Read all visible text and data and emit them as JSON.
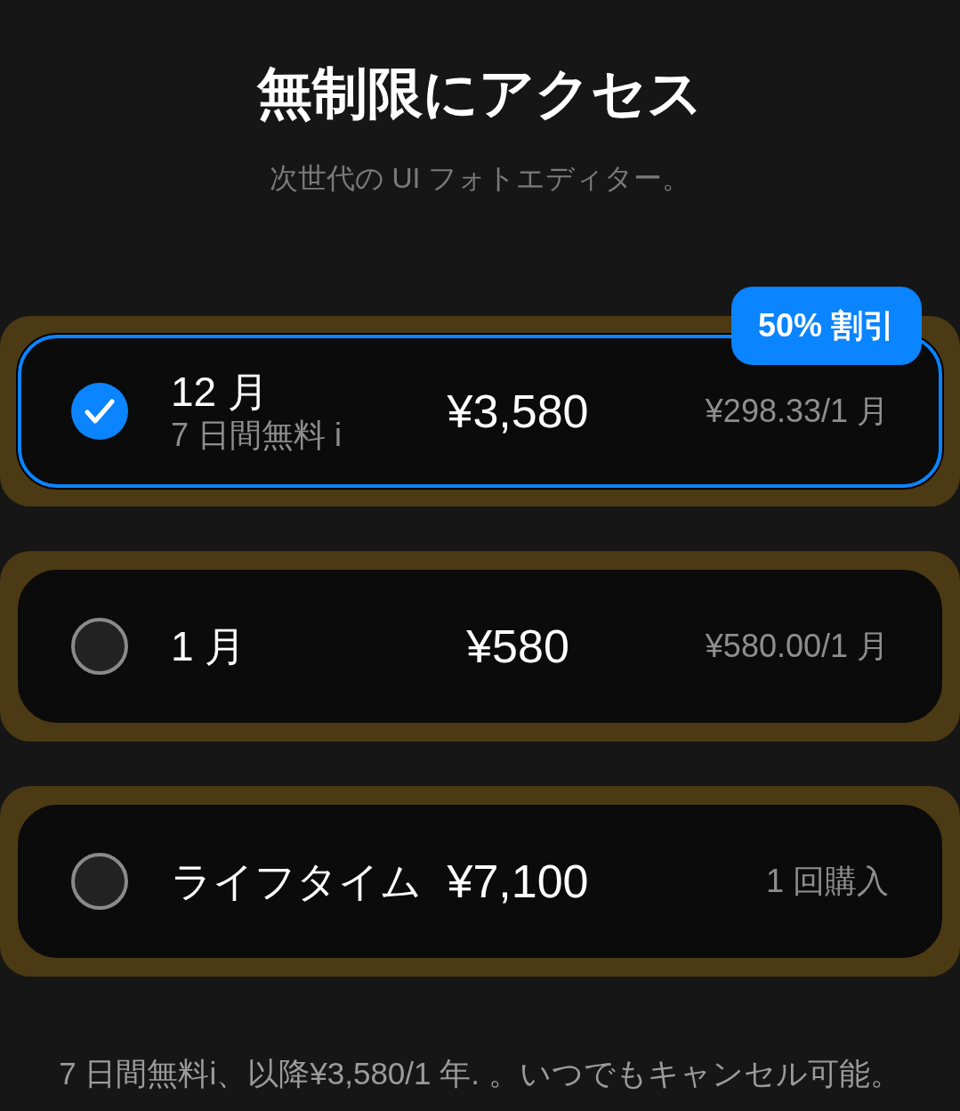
{
  "header": {
    "title": "無制限にアクセス",
    "subtitle": "次世代の UI フォトエディター。"
  },
  "plans": [
    {
      "name": "12 月",
      "note": "7 日間無料 i",
      "price": "¥3,580",
      "per_period": "¥298.33/1 月",
      "badge": "50% 割引",
      "selected": true
    },
    {
      "name": "1 月",
      "price": "¥580",
      "per_period": "¥580.00/1 月",
      "selected": false
    },
    {
      "name": "ライフタイム",
      "price": "¥7,100",
      "per_period": "1 回購入",
      "selected": false
    }
  ],
  "footer": "7 日間無料i、以降¥3,580/1 年. 。いつでもキャンセル可能。"
}
